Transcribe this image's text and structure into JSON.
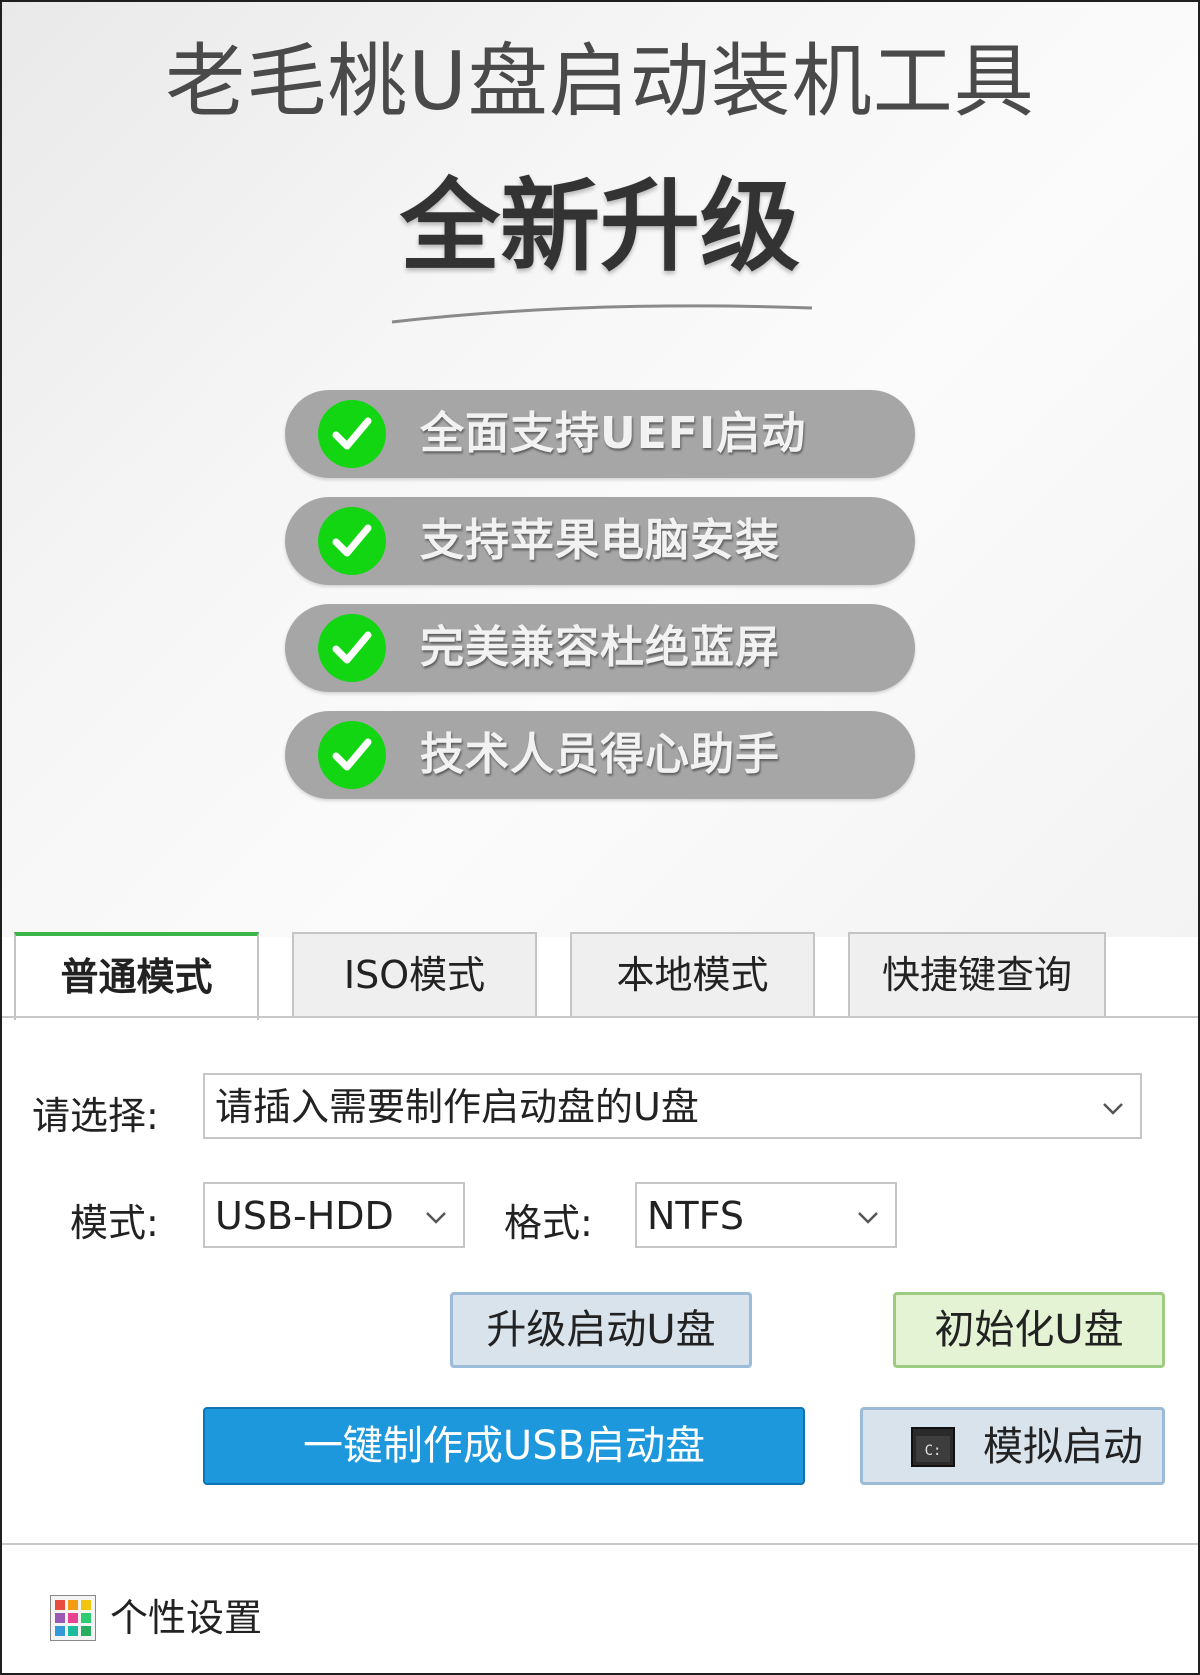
{
  "banner": {
    "title": "老毛桃U盘启动装机工具",
    "subtitle": "全新升级",
    "features": [
      "全面支持UEFI启动",
      "支持苹果电脑安装",
      "完美兼容杜绝蓝屏",
      "技术人员得心助手"
    ]
  },
  "tabs": [
    {
      "label": "普通模式",
      "active": true
    },
    {
      "label": "ISO模式",
      "active": false
    },
    {
      "label": "本地模式",
      "active": false
    },
    {
      "label": "快捷键查询",
      "active": false
    }
  ],
  "form": {
    "select_label": "请选择:",
    "select_value": "请插入需要制作启动盘的U盘",
    "mode_label": "模式:",
    "mode_value": "USB-HDD",
    "format_label": "格式:",
    "format_value": "NTFS"
  },
  "buttons": {
    "upgrade": "升级启动U盘",
    "init": "初始化U盘",
    "make": "一键制作成USB启动盘",
    "simulate": "模拟启动"
  },
  "footer": {
    "settings_label": "个性设置"
  },
  "colors": {
    "tab_accent": "#39b54a",
    "primary_button": "#1e98dc",
    "check_green": "#13d613",
    "feature_pill": "#a6a6a6"
  },
  "icons": {
    "feature_check": "check-icon",
    "dropdown": "chevron-down-icon",
    "simulate": "terminal-icon",
    "settings": "palette-grid-icon"
  }
}
